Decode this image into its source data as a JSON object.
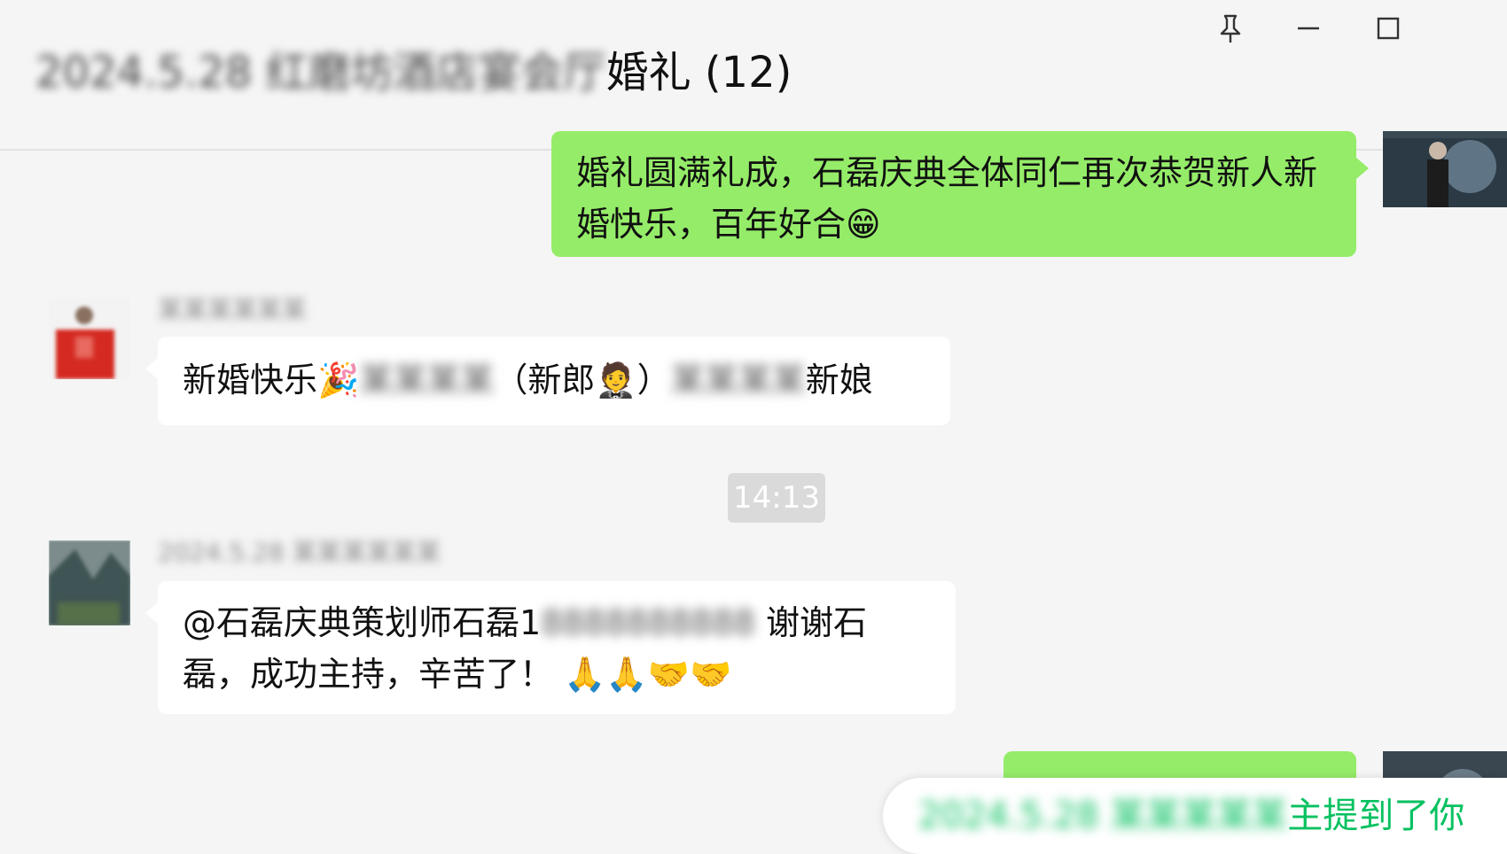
{
  "header": {
    "title_blurred": "2024.5.28 红磨坊酒店宴会厅",
    "title_visible": "婚礼 (12)"
  },
  "window_controls": {
    "pin": "pin-icon",
    "minimize": "minimize-icon",
    "maximize": "maximize-icon"
  },
  "messages": [
    {
      "direction": "out",
      "text": "婚礼圆满礼成，石磊庆典全体同仁再次恭贺新人新婚快乐，百年好合😁"
    },
    {
      "direction": "in",
      "sender_blurred": "某某某某某某",
      "part1": "新婚快乐🎉",
      "blur1": "某某某某",
      "part2": "（新郎🤵）",
      "blur2": "某某某某",
      "part3": "新娘"
    },
    {
      "direction": "in",
      "sender_blurred": "2024.5.28 某某某某某某",
      "part1": "@石磊庆典策划师石磊1",
      "blur1": "8888888888",
      "part2": " 谢谢石磊，成功主持，辛苦了！ 🙏🙏🤝🤝"
    }
  ],
  "timestamp": "14:13",
  "mention_notice": {
    "blurred": "2024.5.28 某某某某某",
    "text": "主提到了你"
  }
}
